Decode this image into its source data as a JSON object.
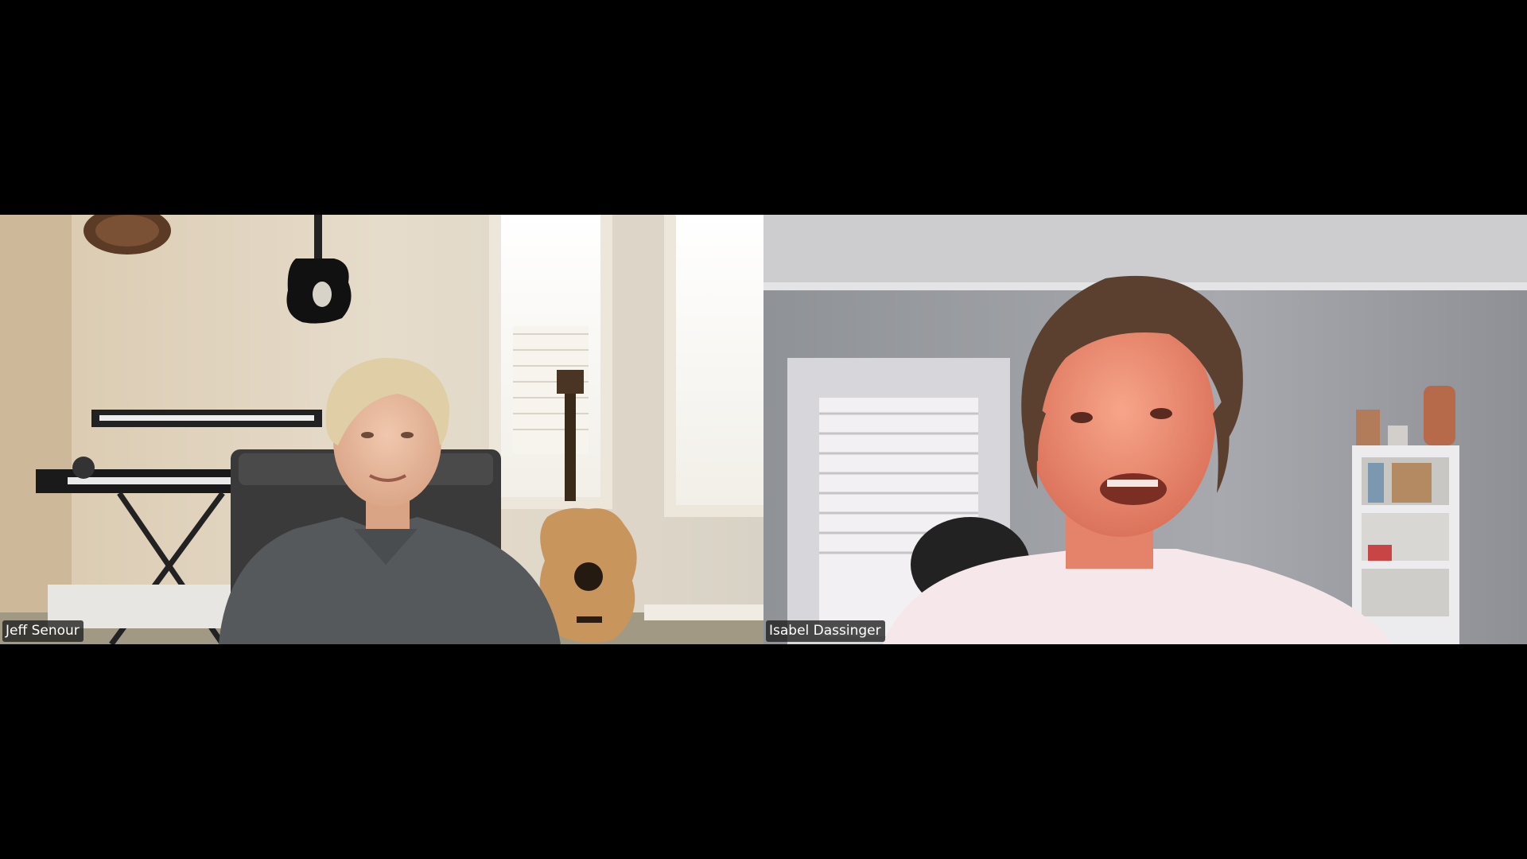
{
  "gallery": {
    "participants": [
      {
        "display_name": "Jeff Senour"
      },
      {
        "display_name": "Isabel Dassinger"
      }
    ]
  },
  "colors": {
    "background": "#000000",
    "name_tag_bg": "#1e1e1e",
    "name_tag_text": "#ffffff"
  }
}
